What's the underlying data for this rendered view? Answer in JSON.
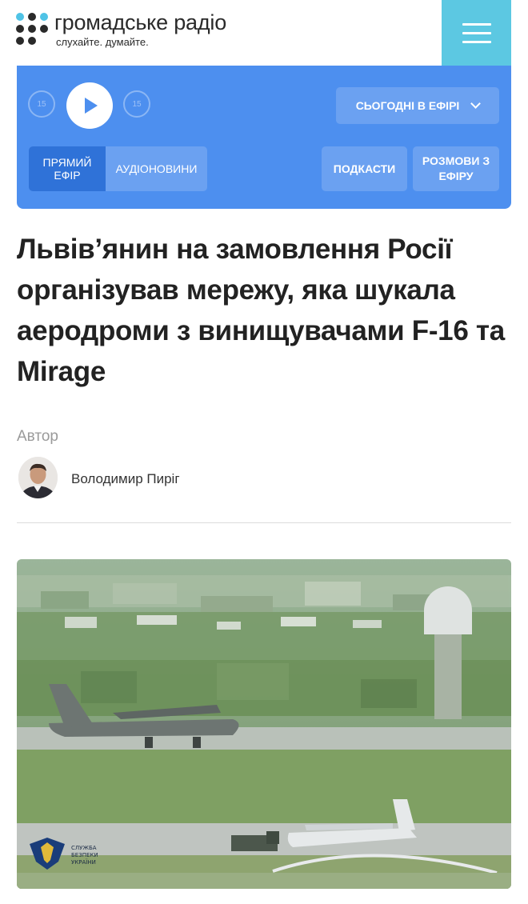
{
  "header": {
    "logo_title": "громадське радіо",
    "logo_subtitle": "слухайте. думайте.",
    "logo_icon": "dots-logo-icon",
    "menu_icon": "hamburger-menu-icon"
  },
  "player": {
    "skip_back_label": "15",
    "skip_forward_label": "15",
    "today_on_air": "СЬОГОДНІ В ЕФІРІ",
    "tab_live": "ПРЯМИЙ ЕФІР",
    "tab_audio_news": "АУДІОНОВИНИ",
    "podcasts": "ПОДКАСТИ",
    "conversations": "РОЗМОВИ З ЕФІРУ"
  },
  "article": {
    "title": "Львів’янин на замовлення Росії організував мережу, яка шукала аеродроми з винищувачами F-16 та Mirage",
    "author_label": "Автор",
    "author_name": "Володимир Пиріг",
    "image_caption_logo": [
      "СЛУЖБА",
      "БЕЗПЕКИ",
      "УКРАЇНИ"
    ]
  },
  "colors": {
    "player_bg": "#4d8fef",
    "live_tab_bg": "#2f72d8",
    "menu_bg": "#5cc8e2",
    "logo_accent": "#4fc3e6"
  }
}
